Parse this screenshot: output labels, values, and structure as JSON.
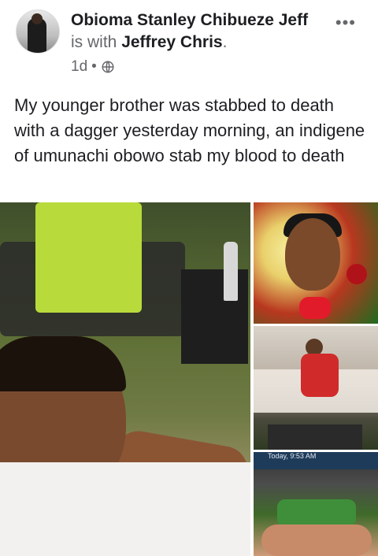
{
  "post": {
    "author": "Obioma Stanley Chibueze Jeff",
    "with_text": "is with",
    "tagged": "Jeffrey Chris",
    "period": ".",
    "time": "1d",
    "separator": "•",
    "privacy_icon": "globe-icon",
    "more_icon": "more-options-icon",
    "more_glyph": "•••",
    "text": "My younger brother was stabbed to death with a dagger yesterday morning, an indigene of umunachi obowo stab my blood to death"
  },
  "photos": [
    {
      "name": "photo-main"
    },
    {
      "name": "photo-portrait"
    },
    {
      "name": "photo-seated"
    },
    {
      "name": "photo-screenshot",
      "status_text": "Today, 9:53 AM"
    }
  ],
  "colors": {
    "text_primary": "#1c1e21",
    "text_secondary": "#65676b",
    "background": "#ffffff"
  }
}
